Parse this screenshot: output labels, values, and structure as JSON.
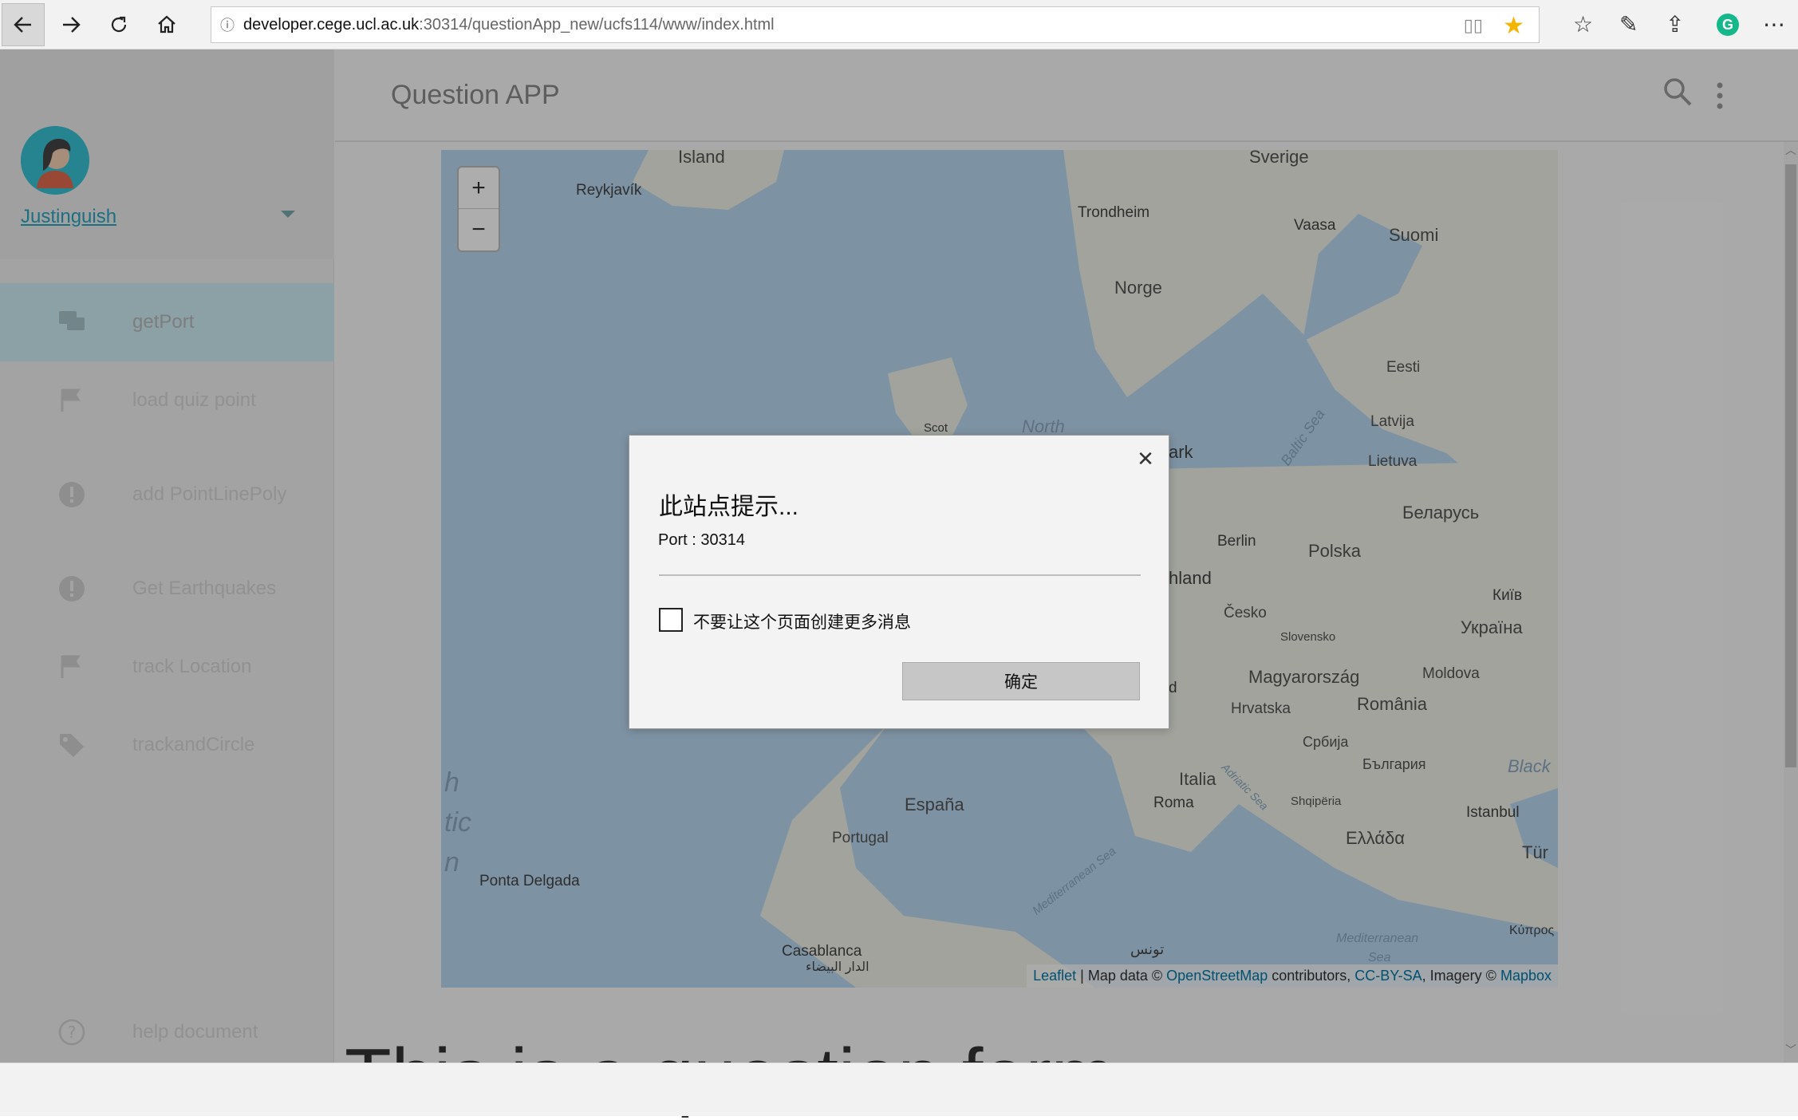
{
  "browser": {
    "url_host": "developer.cege.ucl.ac.uk",
    "url_rest": ":30314/questionApp_new/ucfs114/www/index.html",
    "favorite_star_color": "#f5b400",
    "extension_icon_letter": "G",
    "extension_icon_color": "#14b88a"
  },
  "app": {
    "title": "Question APP",
    "username": "Justinguish",
    "nav_items": [
      {
        "label": "getPort",
        "icon": "chat-icon",
        "active": true
      },
      {
        "label": "load quiz point",
        "icon": "flag-icon",
        "active": false
      },
      {
        "label": "add PointLinePoly",
        "icon": "alert-icon",
        "active": false
      },
      {
        "label": "Get Earthquakes",
        "icon": "alert-icon",
        "active": false
      },
      {
        "label": "track Location",
        "icon": "flag-icon",
        "active": false
      },
      {
        "label": "trackandCircle",
        "icon": "tag-icon",
        "active": false
      }
    ],
    "help_label": "help document",
    "accent_color": "#39c2d5"
  },
  "map": {
    "zoom_in": "+",
    "zoom_out": "−",
    "countries": [
      "Island",
      "Sverige",
      "Suomi",
      "Norge",
      "Eesti",
      "Latvija",
      "Lietuva",
      "Беларусь",
      "Polska",
      "Česko",
      "Slovensko",
      "Україна",
      "Magyarország",
      "Moldova",
      "Hrvatska",
      "România",
      "Србија",
      "България",
      "Shqipëria",
      "Ελλάδα",
      "Italia",
      "España",
      "Portugal",
      "Tür"
    ],
    "cities": [
      "Reykjavík",
      "Trondheim",
      "Vaasa",
      "Berlin",
      "Київ",
      "Roma",
      "Istanbul",
      "Ponta Delgada",
      "Casablanca",
      "الدار البيضاء",
      "Κύπρος",
      "Scot",
      "ark",
      "hland",
      "d",
      "تونس"
    ],
    "seas": [
      "North",
      "Baltic Sea",
      "Black",
      "Mediterranean Sea",
      "Adriatic Sea",
      "Mediterranean",
      "Sea",
      "h",
      "tic",
      "n"
    ],
    "attribution": {
      "leaflet": "Leaflet",
      "sep1": " | Map data © ",
      "osm": "OpenStreetMap",
      "contrib": " contributors, ",
      "license": "CC-BY-SA",
      "imagery": ", Imagery © ",
      "mapbox": "Mapbox"
    }
  },
  "page": {
    "heading": "This is a question form"
  },
  "dialog": {
    "title": "此站点提示...",
    "message": "Port : 30314",
    "checkbox_label": "不要让这个页面创建更多消息",
    "ok_label": "确定"
  }
}
